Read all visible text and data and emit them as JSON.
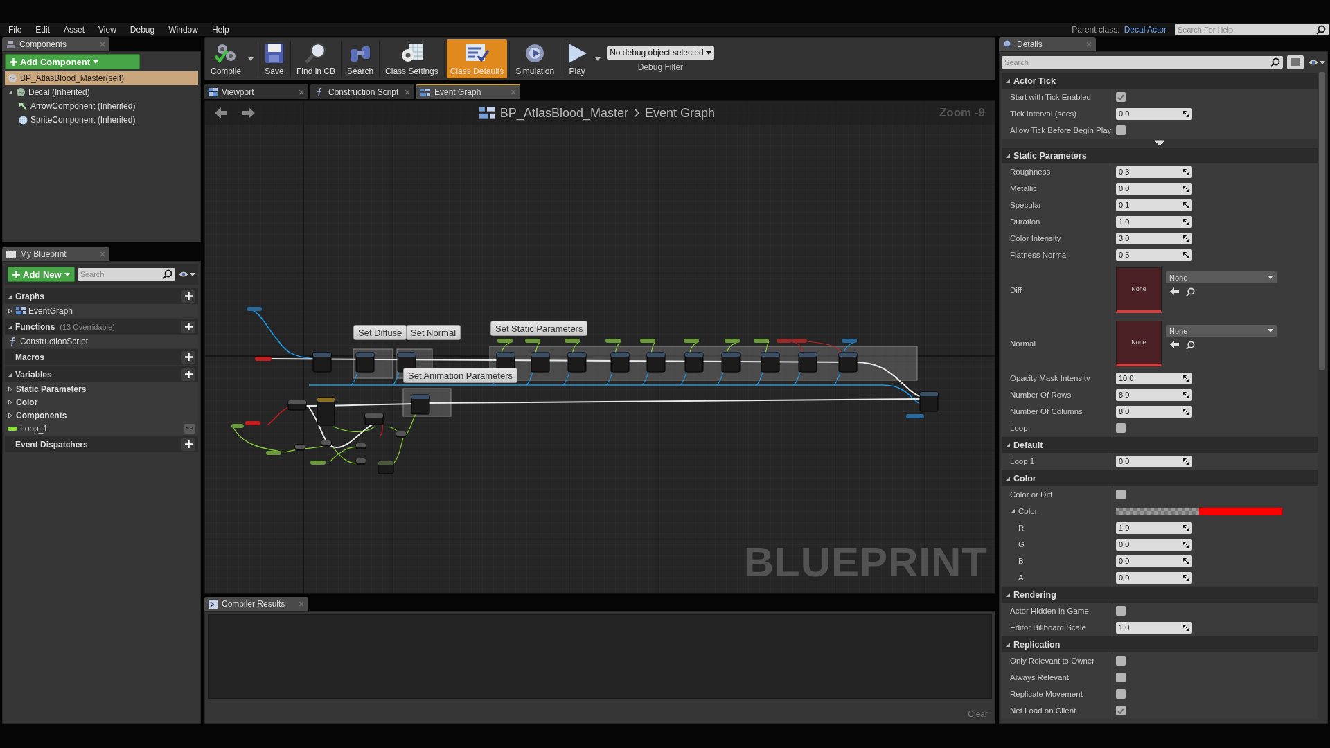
{
  "menu": [
    "File",
    "Edit",
    "Asset",
    "View",
    "Debug",
    "Window",
    "Help"
  ],
  "parent_class": {
    "label": "Parent class:",
    "value": "Decal Actor"
  },
  "help_search": {
    "placeholder": "Search For Help"
  },
  "components": {
    "tab": "Components",
    "add_button": "Add Component",
    "items": [
      {
        "label": "BP_AtlasBlood_Master(self)",
        "kind": "actor",
        "selected": true
      },
      {
        "label": "Decal (Inherited)",
        "kind": "decal",
        "selected": false,
        "expanded": true,
        "children": [
          {
            "label": "ArrowComponent (Inherited)",
            "kind": "arrow",
            "selected": false
          },
          {
            "label": "SpriteComponent (Inherited)",
            "kind": "sprite",
            "selected": false
          }
        ]
      }
    ]
  },
  "my_blueprint": {
    "tab": "My Blueprint",
    "add_button": "Add New",
    "search": {
      "placeholder": "Search"
    },
    "sections": [
      {
        "title": "Graphs",
        "expanded": true,
        "items": [
          {
            "label": "EventGraph",
            "kind": "graph",
            "expanded": false
          }
        ]
      },
      {
        "title": "Functions",
        "note": "(13 Overridable)",
        "expanded": true,
        "items": [
          {
            "label": "ConstructionScript",
            "kind": "function"
          }
        ]
      },
      {
        "title": "Macros"
      },
      {
        "title": "Variables",
        "expanded": true,
        "items": [
          {
            "label": "Static Parameters",
            "kind": "category",
            "expanded": false
          },
          {
            "label": "Color",
            "kind": "category",
            "expanded": false
          },
          {
            "label": "Components",
            "kind": "category",
            "expanded": false
          },
          {
            "label": "Loop_1",
            "kind": "variable"
          }
        ]
      },
      {
        "title": "Event Dispatchers"
      }
    ]
  },
  "toolbar": {
    "buttons": [
      {
        "label": "Compile",
        "kind": "compile",
        "selected": false,
        "dropdown": true
      },
      {
        "label": "Save",
        "kind": "save",
        "selected": false
      },
      {
        "label": "Find in CB",
        "kind": "find",
        "selected": false
      },
      {
        "label": "Search",
        "kind": "search",
        "selected": false
      },
      {
        "label": "Class Settings",
        "kind": "settings",
        "selected": false
      },
      {
        "label": "Class Defaults",
        "kind": "defaults",
        "selected": true
      },
      {
        "label": "Simulation",
        "kind": "simulation",
        "selected": false
      },
      {
        "label": "Play",
        "kind": "play",
        "selected": false,
        "dropdown": true
      }
    ],
    "debug": {
      "value": "No debug object selected",
      "label": "Debug Filter"
    }
  },
  "graph_tabs": [
    {
      "label": "Viewport",
      "kind": "viewport",
      "selected": false
    },
    {
      "label": "Construction Script",
      "kind": "function",
      "selected": false
    },
    {
      "label": "Event Graph",
      "kind": "graph",
      "selected": true
    }
  ],
  "graph": {
    "breadcrumb": [
      "BP_AtlasBlood_Master",
      "Event Graph"
    ],
    "zoom": "Zoom -9",
    "watermark": "BLUEPRINT",
    "comments": [
      {
        "label": "Set Diffuse"
      },
      {
        "label": "Set Normal"
      },
      {
        "label": "Set Static Parameters"
      },
      {
        "label": "Set Animation Parameters"
      }
    ]
  },
  "compiler": {
    "tab": "Compiler Results",
    "clear": "Clear"
  },
  "details": {
    "tab": "Details",
    "search": {
      "placeholder": "Search"
    },
    "sections": [
      {
        "title": "Actor Tick",
        "expanded": true,
        "advanced_expanded": false,
        "rows": [
          {
            "kind": "check",
            "label": "Start with Tick Enabled",
            "checked": true
          },
          {
            "kind": "number",
            "label": "Tick Interval (secs)",
            "value": "0.0"
          },
          {
            "kind": "check",
            "label": "Allow Tick Before Begin Play",
            "checked": false
          }
        ]
      },
      {
        "title": "Static Parameters",
        "expanded": true,
        "rows": [
          {
            "kind": "number",
            "label": "Roughness",
            "value": "0.3"
          },
          {
            "kind": "number",
            "label": "Metallic",
            "value": "0.0"
          },
          {
            "kind": "number",
            "label": "Specular",
            "value": "0.1"
          },
          {
            "kind": "number",
            "label": "Duration",
            "value": "1.0"
          },
          {
            "kind": "number",
            "label": "Color Intensity",
            "value": "3.0"
          },
          {
            "kind": "number",
            "label": "Flatness Normal",
            "value": "0.5"
          },
          {
            "kind": "texture",
            "label": "Diff",
            "preview": "None",
            "value": "None"
          },
          {
            "kind": "texture",
            "label": "Normal",
            "preview": "None",
            "value": "None"
          },
          {
            "kind": "number",
            "label": "Opacity Mask Intensity",
            "value": "10.0"
          },
          {
            "kind": "number",
            "label": "Number Of Rows",
            "value": "8.0"
          },
          {
            "kind": "number",
            "label": "Number Of Columns",
            "value": "8.0"
          },
          {
            "kind": "check",
            "label": "Loop",
            "checked": false
          }
        ]
      },
      {
        "title": "Default",
        "expanded": true,
        "rows": [
          {
            "kind": "number",
            "label": "Loop 1",
            "value": "0.0"
          }
        ]
      },
      {
        "title": "Color",
        "expanded": true,
        "rows": [
          {
            "kind": "check",
            "label": "Color or Diff",
            "checked": false
          },
          {
            "kind": "color",
            "label": "Color",
            "color": "#ff0000",
            "expanded": true,
            "children": [
              {
                "kind": "number",
                "label": "R",
                "value": "1.0"
              },
              {
                "kind": "number",
                "label": "G",
                "value": "0.0"
              },
              {
                "kind": "number",
                "label": "B",
                "value": "0.0"
              },
              {
                "kind": "number",
                "label": "A",
                "value": "0.0"
              }
            ]
          }
        ]
      },
      {
        "title": "Rendering",
        "expanded": true,
        "rows": [
          {
            "kind": "check",
            "label": "Actor Hidden In Game",
            "checked": false
          },
          {
            "kind": "number",
            "label": "Editor Billboard Scale",
            "value": "1.0"
          }
        ]
      },
      {
        "title": "Replication",
        "expanded": true,
        "rows": [
          {
            "kind": "check",
            "label": "Only Relevant to Owner",
            "checked": false
          },
          {
            "kind": "check",
            "label": "Always Relevant",
            "checked": false
          },
          {
            "kind": "check",
            "label": "Replicate Movement",
            "checked": false
          },
          {
            "kind": "check",
            "label": "Net Load on Client",
            "checked": true
          }
        ]
      }
    ]
  }
}
